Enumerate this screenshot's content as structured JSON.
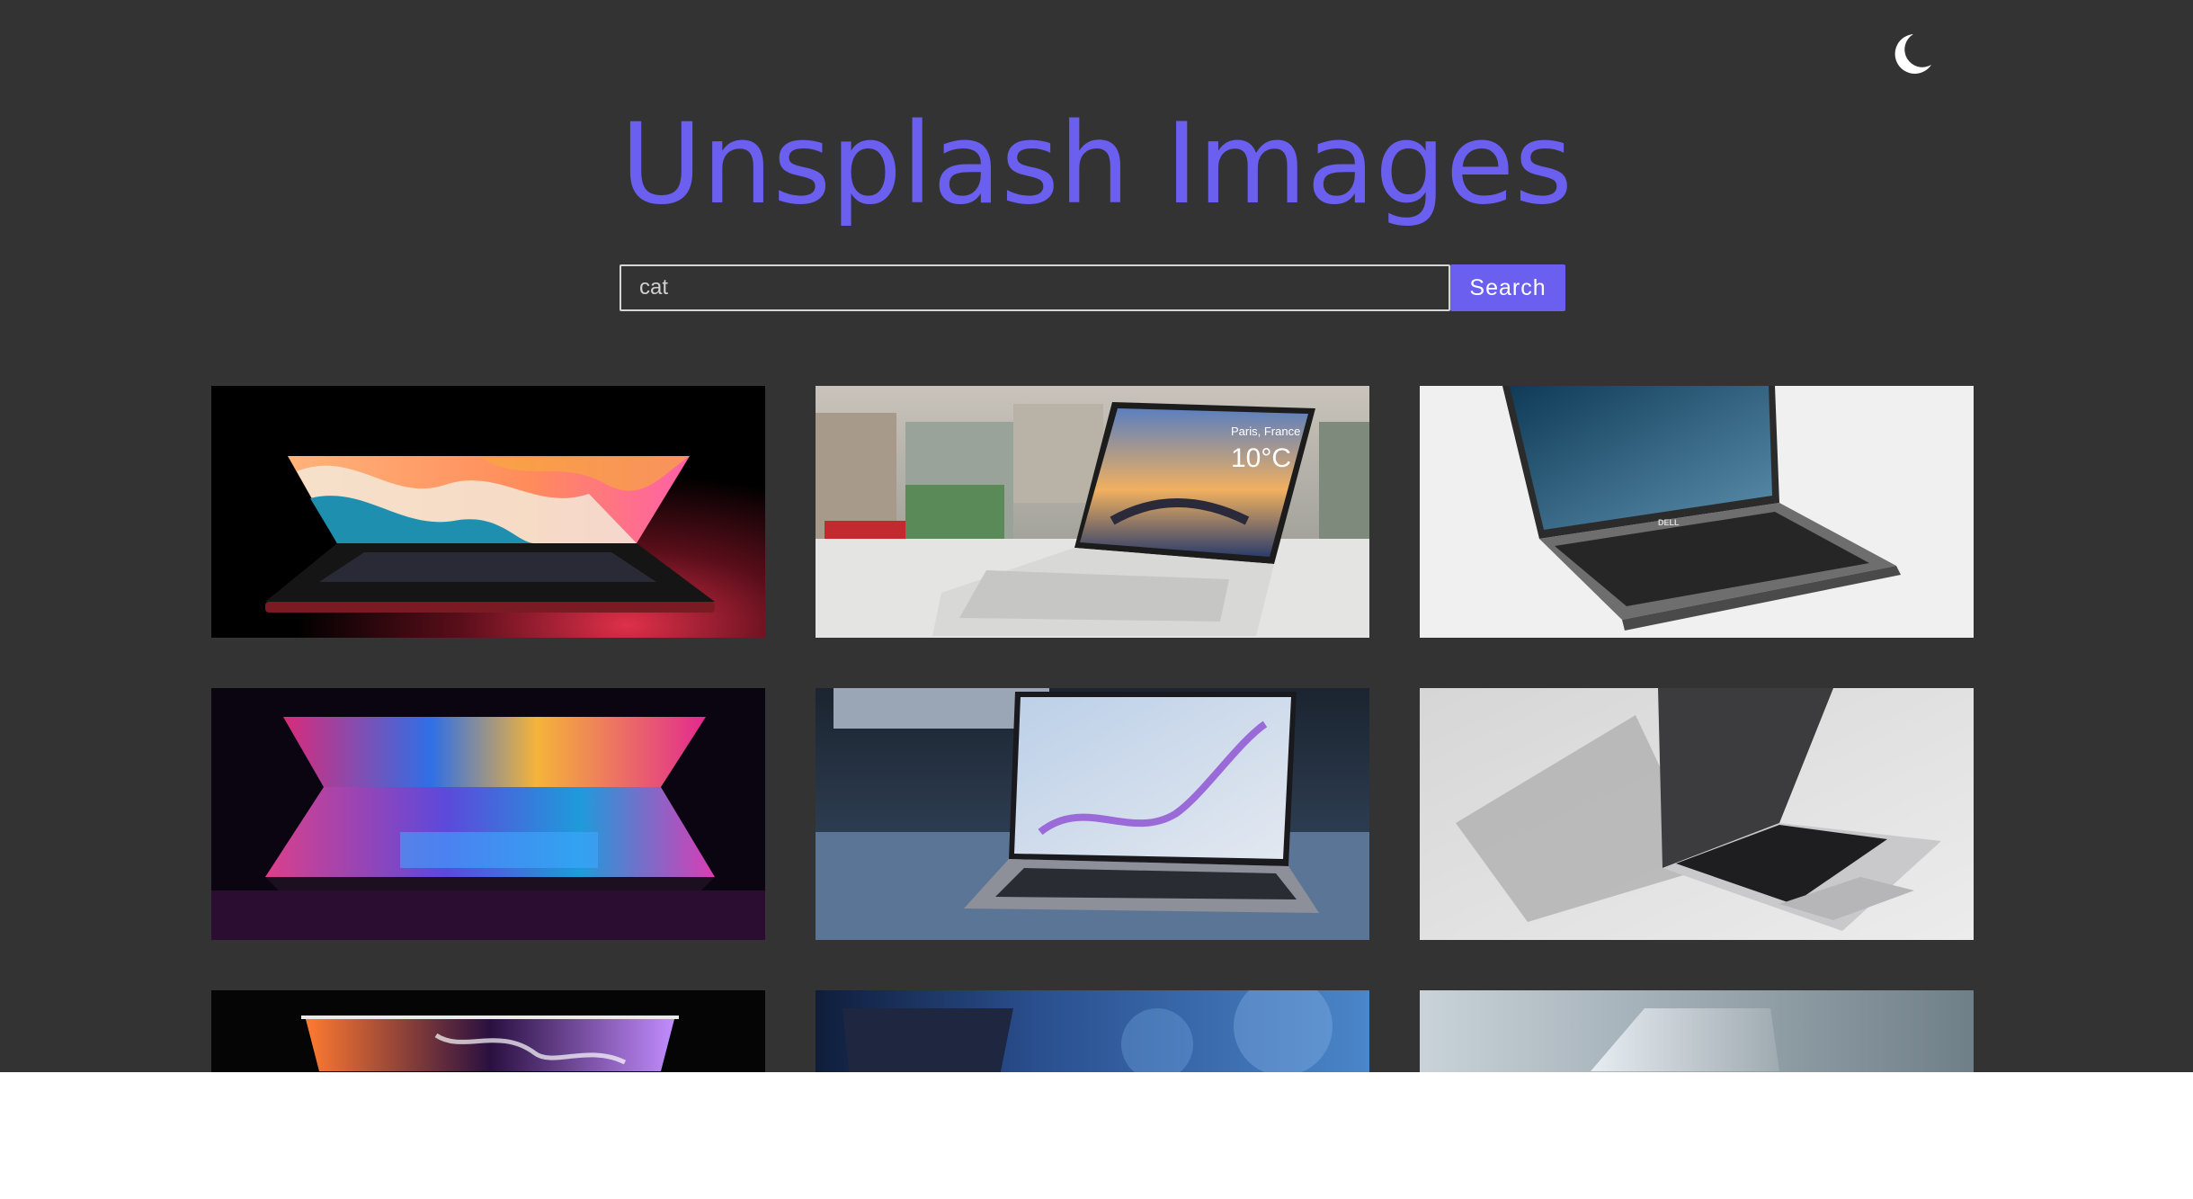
{
  "app": {
    "title": "Unsplash Images"
  },
  "theme": {
    "icon": "moon-icon",
    "moon_color": "#ffffff"
  },
  "search": {
    "value": "cat",
    "button_label": "Search"
  },
  "colors": {
    "background": "#333333",
    "accent": "#6b5ff0",
    "page_below": "#ffffff"
  },
  "images": [
    {
      "name": "laptop-rainbow-wave-photo",
      "subject": "laptop with orange, white and teal wave wallpaper"
    },
    {
      "name": "laptop-paris-weather-photo",
      "subject": "silver laptop showing Paris weather widget",
      "screen_text": {
        "city": "Paris, France",
        "temp": "10°C"
      }
    },
    {
      "name": "laptop-windows-dell-photo",
      "subject": "grey laptop with Windows desktop on white surface",
      "brand": "DELL"
    },
    {
      "name": "laptop-neon-keyboard-photo",
      "subject": "laptop with neon multicolor backlit screen"
    },
    {
      "name": "laptop-marble-screen-photo",
      "subject": "laptop with marbled blue and purple wallpaper by a window"
    },
    {
      "name": "laptop-silver-open-photo",
      "subject": "open silver laptop on white background"
    },
    {
      "name": "laptop-dark-swirl-photo",
      "subject": "laptop with dark colorful swirl wallpaper"
    },
    {
      "name": "laptop-blue-bokeh-photo",
      "subject": "laptop lid against blue blurred background"
    },
    {
      "name": "laptop-silver-lid-photo",
      "subject": "closed silver laptop lid"
    }
  ]
}
